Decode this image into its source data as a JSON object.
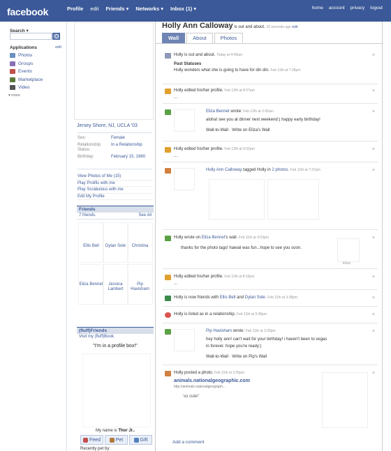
{
  "header": {
    "logo": "facebook",
    "nav": [
      {
        "label": "Profile"
      },
      {
        "label": "edit"
      },
      {
        "label": "Friends ▾"
      },
      {
        "label": "Networks ▾"
      },
      {
        "label": "Inbox (1) ▾"
      }
    ],
    "nav_right": [
      "home",
      "account",
      "privacy",
      "logout"
    ]
  },
  "left_sidebar": {
    "search_label": "Search ▾",
    "search_placeholder": "",
    "applications_label": "Applications",
    "edit_label": "edit",
    "apps": [
      {
        "label": "Photos",
        "icon": "photos-icon",
        "color": "#6a8ebf"
      },
      {
        "label": "Groups",
        "icon": "groups-icon",
        "color": "#8a6fb5"
      },
      {
        "label": "Events",
        "icon": "events-icon",
        "color": "#c0504d"
      },
      {
        "label": "Marketplace",
        "icon": "marketplace-icon",
        "color": "#5a7a3c"
      },
      {
        "label": "Video",
        "icon": "video-icon",
        "color": "#555555"
      }
    ],
    "more_label": "▾ more"
  },
  "profile": {
    "network": "Jersey Shore, NJ, UCLA '03",
    "info": [
      {
        "key": "Sex:",
        "value": "Female"
      },
      {
        "key": "Relationship Status:",
        "value": "In a Relationship"
      },
      {
        "key": "Birthday:",
        "value": "February 15, 1980"
      }
    ],
    "links": [
      "View Photos of Me (15)",
      "Play Prolific with me",
      "Play Scrabulous with me",
      "Edit My Profile"
    ],
    "friends": {
      "title": "Friends",
      "count": "7 friends.",
      "see_all": "See All",
      "people": [
        "Ellis Bell",
        "Dylan Sole",
        "Christina",
        "Eliza Bennet",
        "Jessica Lambert",
        "Pip Havisham"
      ]
    },
    "fluff": {
      "title": "(fluff)Friends",
      "link": "Visit my (fluff)Book.",
      "profile_box": "\"I'm in a profile box!\"",
      "my_name_prefix": "My name is",
      "my_name": "Thor Jr..",
      "buttons": [
        "Feed",
        "Pet",
        "Gift"
      ],
      "recently": "Recently pet by:"
    }
  },
  "main": {
    "name": "Holly Ann Calloway",
    "status": "is out and about.",
    "status_time": "33 seconds ago",
    "status_edit": "edit",
    "tabs": [
      "Wall",
      "About",
      "Photos"
    ],
    "stories": [
      {
        "actor": "Holly",
        "text": "is out and about.",
        "time": "Today at 4:49am",
        "extra_title": "Past Statuses",
        "extra": "Holly wonders what she is going to have for din din.",
        "extra_time": "Feb 11th at 7:18pm"
      },
      {
        "text": "Holly edited his/her profile.",
        "time": "Feb 12th at 8:07am",
        "dots": "..."
      },
      {
        "actor": "Eliza Bennet",
        "verb": "wrote:",
        "time": "Feb 12th at 2:42am",
        "message": "aloha! see you at dinner next weekend:) happy early birthday!",
        "links": "Wall-to-Wall · Write on Eliza's Wall"
      },
      {
        "text": "Holly edited his/her profile.",
        "time": "Feb 12th at 9:02pm",
        "dots": "..."
      },
      {
        "actor": "Holly Ann Calloway",
        "verb": "tagged Holly in",
        "target": "2 photos.",
        "time": "Feb 11th at 7:37pm"
      },
      {
        "prefix": "Holly wrote on",
        "target": "Eliza Bennet",
        "suffix": "'s wall.",
        "time": "Feb 11th at 4:53pm",
        "message": "thanks for the photo tags! hawaii was fun...hope to see you soon.",
        "thumb_label": "Eliza"
      },
      {
        "text": "Holly edited his/her profile.",
        "time": "Feb 11th at 8:16pm",
        "dots": "..."
      },
      {
        "prefix": "Holly is now friends with",
        "a": "Ellis Bell",
        "and": "and",
        "b": "Dylan Sole.",
        "time": "Feb 11th at 3:38pm"
      },
      {
        "text": "Holly is listed as in a relationship.",
        "time": "Feb 11th at 3:38pm"
      },
      {
        "actor": "Pip Havisham",
        "verb": "wrote:",
        "time": "Feb 11th at 3:35pm",
        "message1": "hey holly ann! can't wait for your birthday! i haven't been to vegas",
        "message2": "in forever. hope you're ready:)",
        "links": "Wall-to-Wall · Write on Pip's Wall"
      },
      {
        "text": "Holly posted a photo.",
        "time": "Feb 11th at 3:35pm",
        "link_title": "animals.nationalgeographic.com",
        "url": "http://animals.nationalgeograph...",
        "caption": "so cute!"
      }
    ],
    "add_comment": "Add a comment"
  },
  "colors": {
    "brand": "#3b5998",
    "tab_active": "#6d84b4",
    "box_head": "#d8dfea"
  }
}
